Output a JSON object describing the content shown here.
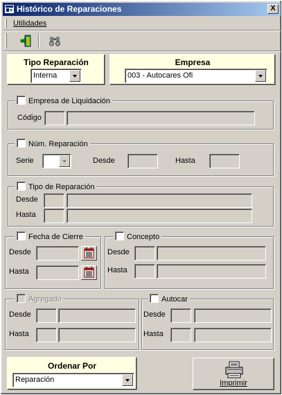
{
  "window": {
    "title": "Histórico de Reparaciones",
    "close_label": "X"
  },
  "menu": {
    "utilidades": "Utilidades"
  },
  "toolbar": {
    "buttons": [
      "exit-door-icon",
      "binoculars-icon"
    ]
  },
  "tipo_reparacion": {
    "label": "Tipo Reparación",
    "value": "Interna"
  },
  "empresa": {
    "label": "Empresa",
    "value": "003 - Autocares Ofi"
  },
  "empresa_liquidacion": {
    "title": "Empresa de Liquidación",
    "codigo_label": "Código"
  },
  "num_reparacion": {
    "title": "Núm. Reparación",
    "serie_label": "Serie",
    "desde_label": "Desde",
    "hasta_label": "Hasta"
  },
  "tipo_de_reparacion": {
    "title": "Tipo de Reparación",
    "desde_label": "Desde",
    "hasta_label": "Hasta"
  },
  "fecha_cierre": {
    "title": "Fecha de Cierre",
    "desde_label": "Desde",
    "hasta_label": "Hasta"
  },
  "concepto": {
    "title": "Concepto",
    "desde_label": "Desde",
    "hasta_label": "Hasta"
  },
  "agregado": {
    "title": "Agregado",
    "desde_label": "Desde",
    "hasta_label": "Hasta"
  },
  "autocar": {
    "title": "Autocar",
    "desde_label": "Desde",
    "hasta_label": "Hasta"
  },
  "ordenar": {
    "label": "Ordenar Por",
    "value": "Reparación"
  },
  "imprimir": {
    "label": "Imprimir"
  },
  "colors": {
    "title_start": "#0a246a",
    "title_end": "#a6caf0",
    "panel_yellow": "#ffffe1",
    "face": "#d4d0c8"
  }
}
